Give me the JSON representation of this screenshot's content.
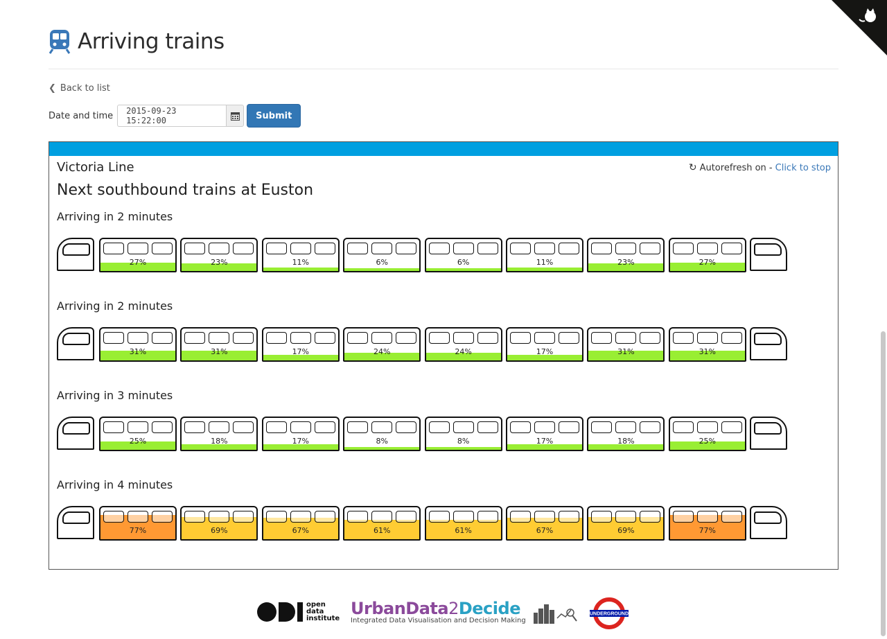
{
  "header": {
    "title": "Arriving trains",
    "back_label": "Back to list"
  },
  "form": {
    "date_label": "Date and time",
    "date_value": "2015-09-23 15:22:00",
    "submit_label": "Submit"
  },
  "panel": {
    "line_name": "Victoria Line",
    "line_color": "#009fe0",
    "autorefresh_label": "Autorefresh on -",
    "autorefresh_link": "Click to stop",
    "station_title": "Next southbound trains at Euston"
  },
  "arrivals": [
    {
      "label": "Arriving in 2 minutes",
      "cars": [
        {
          "pct": "27%",
          "level": 0.27
        },
        {
          "pct": "23%",
          "level": 0.23
        },
        {
          "pct": "11%",
          "level": 0.11
        },
        {
          "pct": "6%",
          "level": 0.06
        },
        {
          "pct": "6%",
          "level": 0.06
        },
        {
          "pct": "11%",
          "level": 0.11
        },
        {
          "pct": "23%",
          "level": 0.23
        },
        {
          "pct": "27%",
          "level": 0.27
        }
      ]
    },
    {
      "label": "Arriving in 2 minutes",
      "cars": [
        {
          "pct": "31%",
          "level": 0.31
        },
        {
          "pct": "31%",
          "level": 0.31
        },
        {
          "pct": "17%",
          "level": 0.17
        },
        {
          "pct": "24%",
          "level": 0.24
        },
        {
          "pct": "24%",
          "level": 0.24
        },
        {
          "pct": "17%",
          "level": 0.17
        },
        {
          "pct": "31%",
          "level": 0.31
        },
        {
          "pct": "31%",
          "level": 0.31
        }
      ]
    },
    {
      "label": "Arriving in 3 minutes",
      "cars": [
        {
          "pct": "25%",
          "level": 0.25
        },
        {
          "pct": "18%",
          "level": 0.18
        },
        {
          "pct": "17%",
          "level": 0.17
        },
        {
          "pct": "8%",
          "level": 0.08
        },
        {
          "pct": "8%",
          "level": 0.08
        },
        {
          "pct": "17%",
          "level": 0.17
        },
        {
          "pct": "18%",
          "level": 0.18
        },
        {
          "pct": "25%",
          "level": 0.25
        }
      ]
    },
    {
      "label": "Arriving in 4 minutes",
      "cars": [
        {
          "pct": "77%",
          "level": 0.77
        },
        {
          "pct": "69%",
          "level": 0.69
        },
        {
          "pct": "67%",
          "level": 0.67
        },
        {
          "pct": "61%",
          "level": 0.61
        },
        {
          "pct": "61%",
          "level": 0.61
        },
        {
          "pct": "67%",
          "level": 0.67
        },
        {
          "pct": "69%",
          "level": 0.69
        },
        {
          "pct": "77%",
          "level": 0.77
        }
      ]
    }
  ],
  "colors": {
    "low_load": "#99ee33",
    "medium_load": "#ffcc33",
    "high_load": "#ff9933"
  },
  "footer": {
    "odi_text": [
      "open",
      "data",
      "institute"
    ],
    "ud_urban": "UrbanData",
    "ud_two": "2",
    "ud_decide": "Decide",
    "ud_sub": "Integrated Data Visualisation and Decision Making",
    "roundel_text": "UNDERGROUND"
  }
}
